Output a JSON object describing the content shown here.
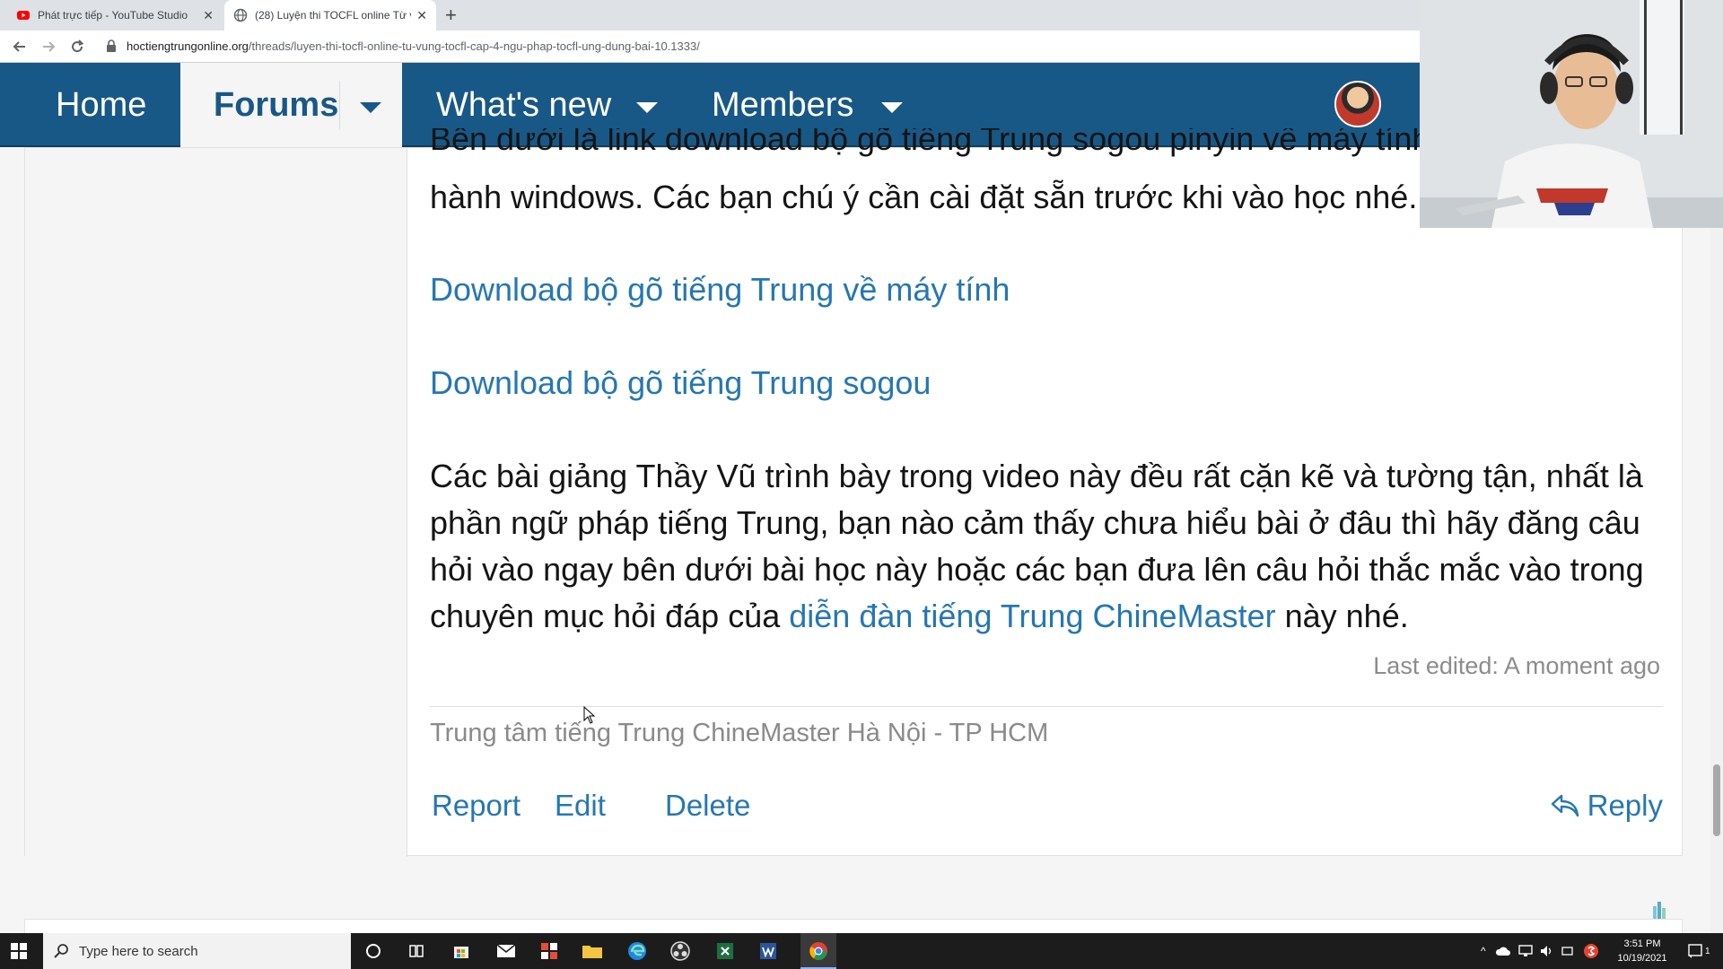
{
  "browser": {
    "tabs": [
      {
        "title": "Phát trực tiếp - YouTube Studio",
        "close": "✕"
      },
      {
        "title": "(28) Luyện thi TOCFL online Từ v",
        "close": "✕"
      }
    ],
    "new_tab": "+",
    "url_domain": "hoctiengtrungonline.org",
    "url_path": "/threads/luyen-thi-tocfl-online-tu-vung-tocfl-cap-4-ngu-phap-tocfl-ung-dung-bai-10.1333/"
  },
  "forum_nav": {
    "home": "Home",
    "forums": "Forums",
    "whats_new": "What's new",
    "members": "Members"
  },
  "post": {
    "top_line": "Bên dưới là link download bộ gõ tiếng Trung sogou pinyin về máy tính",
    "second_line": "hành windows. Các bạn chú ý cần cài đặt sẵn trước khi vào học nhé.",
    "link1": "Download bộ gõ tiếng Trung về máy tính",
    "link2": "Download bộ gõ tiếng Trung sogou",
    "body_before_link": "Các bài giảng Thầy Vũ trình bày trong video này đều rất cặn kẽ và tường tận, nhất là phần ngữ pháp tiếng Trung, bạn nào cảm thấy chưa hiểu bài ở đâu thì hãy đăng câu hỏi vào ngay bên dưới bài học này hoặc các bạn đưa lên câu hỏi thắc mắc vào trong chuyên mục hỏi đáp của ",
    "body_link": "diễn đàn tiếng Trung ChineMaster",
    "body_after_link": " này nhé.",
    "last_edited": "Last edited: A moment ago",
    "signature": "Trung tâm tiếng Trung ChineMaster Hà Nội - TP HCM",
    "actions": {
      "report": "Report",
      "edit": "Edit",
      "delete": "Delete",
      "reply": "Reply"
    }
  },
  "taskbar": {
    "search_placeholder": "Type here to search",
    "time": "3:51 PM",
    "date": "10/19/2021",
    "notification_count": "1"
  },
  "colors": {
    "nav_bg": "#185886",
    "link": "#2577b1",
    "taskbar": "#1c1c1c"
  }
}
